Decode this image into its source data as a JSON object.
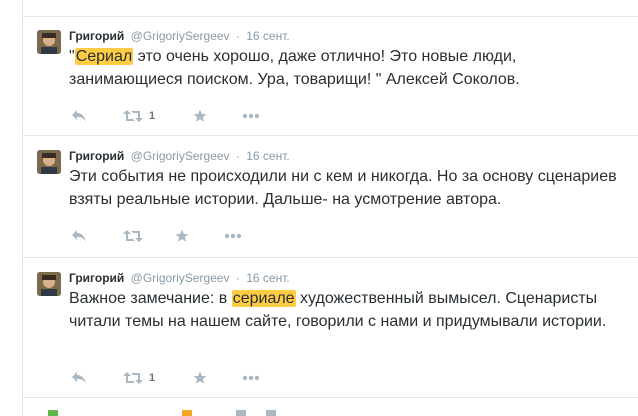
{
  "tweets": [
    {
      "fullname": "Григорий",
      "username": "@GrigoriySergeev",
      "dot": "·",
      "time": "16 сент.",
      "text_parts": [
        {
          "text": "\"",
          "hl": false
        },
        {
          "text": "Сериал",
          "hl": true
        },
        {
          "text": " это очень хорошо, даже отлично! Это новые люди, занимающиеся поиском. Ура, товарищи! \" Алексей Соколов.",
          "hl": false
        }
      ],
      "retweet_count": "1"
    },
    {
      "fullname": "Григорий",
      "username": "@GrigoriySergeev",
      "dot": "·",
      "time": "16 сент.",
      "text_parts": [
        {
          "text": "Эти события не происходили ни с кем и никогда. Но за основу сценариев взяты реальные истории. Дальше- на усмотрение автора.",
          "hl": false
        }
      ],
      "retweet_count": ""
    },
    {
      "fullname": "Григорий",
      "username": "@GrigoriySergeev",
      "dot": "·",
      "time": "16 сент.",
      "text_parts": [
        {
          "text": "Важное замечание: в ",
          "hl": false
        },
        {
          "text": "сериале",
          "hl": true
        },
        {
          "text": " художественный вымысел. Сценаристы читали темы на нашем сайте, говорили с нами и придумывали истории.",
          "hl": false
        }
      ],
      "retweet_count": "1"
    }
  ],
  "colors": {
    "highlight": "#ffcc44",
    "action_icon": "#aab8c2",
    "border": "#e1e8ed",
    "meta_text": "#8899a6"
  },
  "icons": [
    "reply-icon",
    "retweet-icon",
    "favorite-icon",
    "more-icon"
  ]
}
